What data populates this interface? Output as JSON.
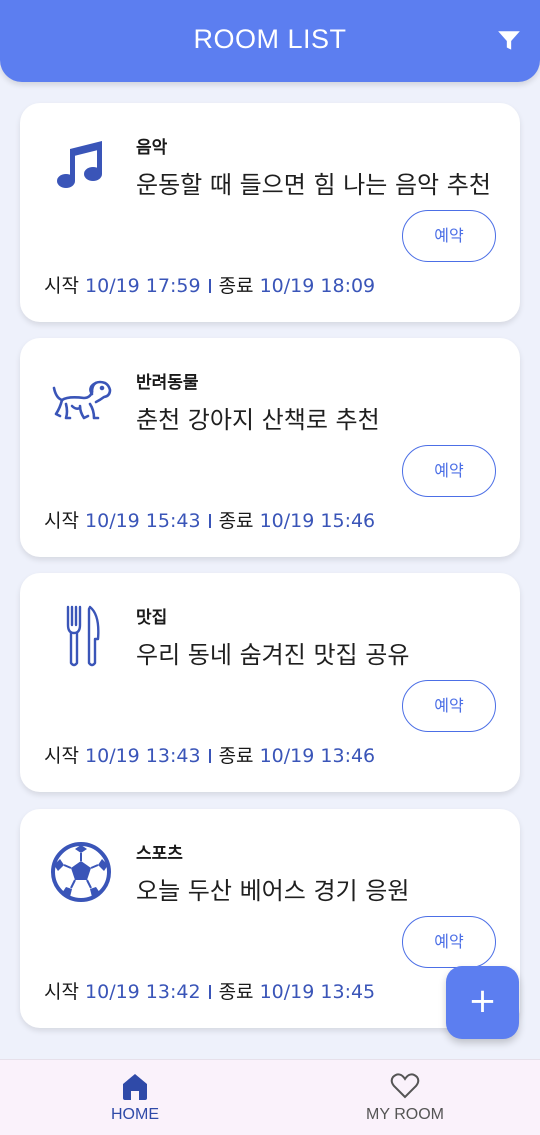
{
  "header": {
    "title": "ROOM LIST",
    "filter_icon": "filter-icon"
  },
  "rooms": [
    {
      "icon": "music-note-icon",
      "category": "음악",
      "title": "운동할 때 들으면 힘 나는 음악 추천",
      "reserve_label": "예약",
      "start_label": "시작",
      "start_time": "10/19 17:59",
      "end_label": "종료",
      "end_time": "10/19 18:09"
    },
    {
      "icon": "dog-icon",
      "category": "반려동물",
      "title": "춘천 강아지 산책로 추천",
      "reserve_label": "예약",
      "start_label": "시작",
      "start_time": "10/19 15:43",
      "end_label": "종료",
      "end_time": "10/19 15:46"
    },
    {
      "icon": "fork-knife-icon",
      "category": "맛집",
      "title": "우리 동네 숨겨진 맛집 공유",
      "reserve_label": "예약",
      "start_label": "시작",
      "start_time": "10/19 13:43",
      "end_label": "종료",
      "end_time": "10/19 13:46"
    },
    {
      "icon": "soccer-ball-icon",
      "category": "스포츠",
      "title": "오늘 두산 베어스 경기 응원",
      "reserve_label": "예약",
      "start_label": "시작",
      "start_time": "10/19 13:42",
      "end_label": "종료",
      "end_time": "10/19 13:45"
    }
  ],
  "fab": {
    "label": "+",
    "icon": "plus-icon"
  },
  "nav": {
    "home_label": "HOME",
    "home_icon": "home-icon",
    "myroom_label": "MY ROOM",
    "myroom_icon": "heart-icon",
    "active": "home"
  },
  "colors": {
    "accent": "#5c7ef0",
    "time_value": "#3a55b8",
    "icon": "#3a55b8",
    "background": "#eef1fb"
  }
}
